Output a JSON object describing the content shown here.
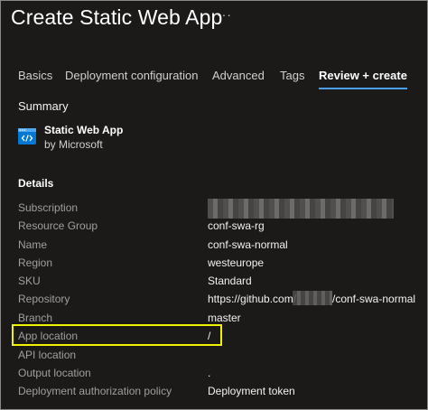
{
  "header": {
    "title": "Create Static Web App",
    "more": "···"
  },
  "tabs": [
    {
      "label": "Basics",
      "active": false
    },
    {
      "label": "Deployment configuration",
      "active": false
    },
    {
      "label": "Advanced",
      "active": false
    },
    {
      "label": "Tags",
      "active": false
    },
    {
      "label": "Review + create",
      "active": true
    }
  ],
  "summary": {
    "heading": "Summary",
    "app_name": "Static Web App",
    "publisher": "by Microsoft",
    "icon": "static-web-app-icon"
  },
  "details": {
    "heading": "Details",
    "rows": [
      {
        "label": "Subscription",
        "value": ""
      },
      {
        "label": "Resource Group",
        "value": "conf-swa-rg"
      },
      {
        "label": "Name",
        "value": "conf-swa-normal"
      },
      {
        "label": "Region",
        "value": "westeurope"
      },
      {
        "label": "SKU",
        "value": "Standard"
      },
      {
        "label": "Repository",
        "value": "https://github.com/",
        "value_suffix": "/conf-swa-normal"
      },
      {
        "label": "Branch",
        "value": "master"
      },
      {
        "label": "App location",
        "value": "/"
      },
      {
        "label": "API location",
        "value": ""
      },
      {
        "label": "Output location",
        "value": "."
      },
      {
        "label": "Deployment authorization policy",
        "value": "Deployment token"
      }
    ]
  },
  "colors": {
    "background": "#1b1a19",
    "accent": "#4aa0e6",
    "highlight": "#f2f200"
  }
}
